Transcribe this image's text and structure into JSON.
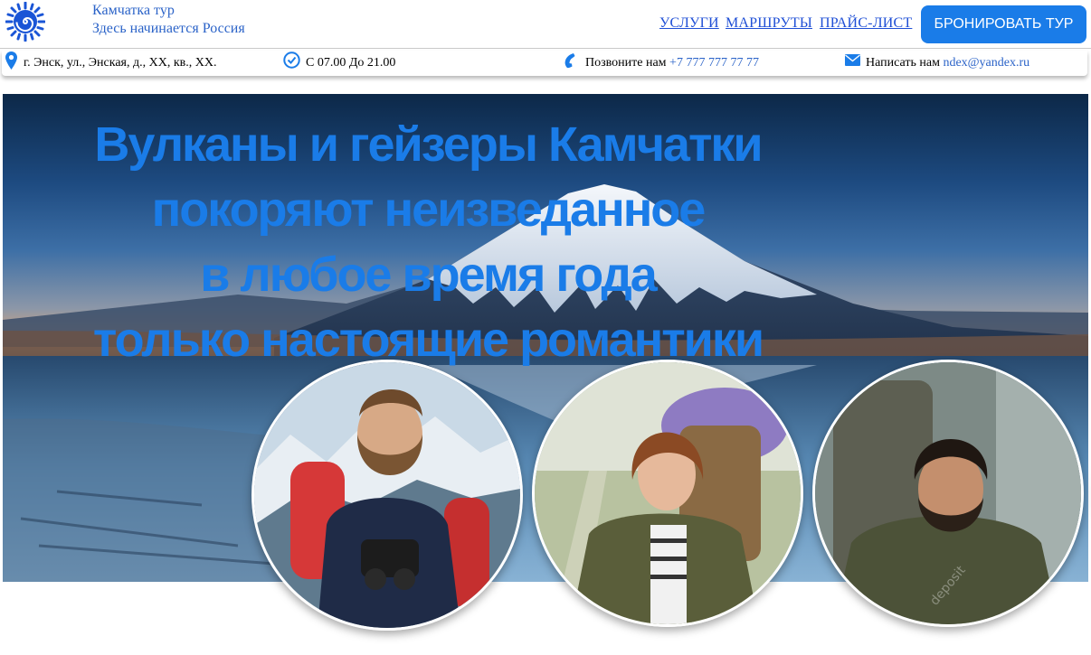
{
  "header": {
    "brand_line1": "Камчатка тур",
    "brand_line2": "Здесь начинается Россия",
    "nav": [
      "УСЛУГИ",
      "МАРШРУТЫ",
      "ПРАЙС-ЛИСТ"
    ],
    "book_button": "БРОНИРОВАТЬ  ТУР"
  },
  "info": {
    "address": "г. Энск, ул., Энская, д., XX, кв., XX.",
    "hours": "С 07.00 До 21.00",
    "call_label": "Позвоните нам",
    "phone": "+7 777 777 77 77",
    "write_label": "Написать нам",
    "email": "ndex@yandex.ru"
  },
  "hero": {
    "lines": [
      "Вулканы и гейзеры Камчатки",
      "покоряют неизведанное",
      "в любое время года",
      "только настоящие романтики"
    ]
  },
  "people": [
    {
      "name": "bearded-hiker-photo"
    },
    {
      "name": "woman-hiker-photo"
    },
    {
      "name": "man-hiker-photo"
    }
  ],
  "colors": {
    "accent": "#1a7ce8",
    "link": "#1f4fd6",
    "brand_text": "#2b63c8"
  }
}
